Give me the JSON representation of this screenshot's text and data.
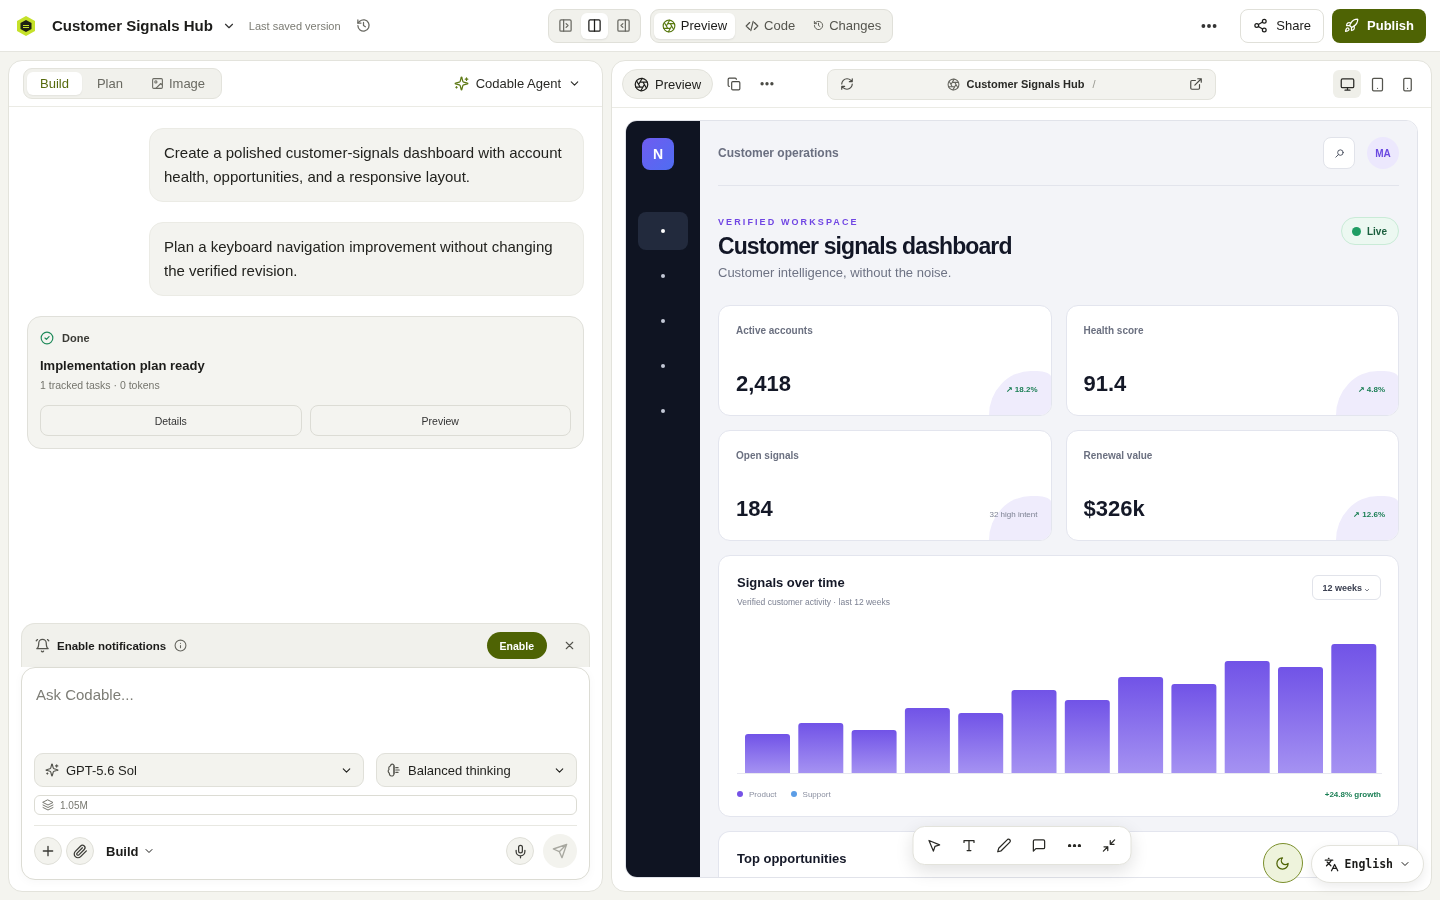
{
  "header": {
    "project_title": "Customer Signals Hub",
    "save_status": "Last saved version",
    "layout_toggles": [
      {
        "kind": "left_panel",
        "selected": false
      },
      {
        "kind": "split",
        "selected": true
      },
      {
        "kind": "right_panel",
        "selected": false
      }
    ],
    "view_tabs": [
      {
        "kind": "preview",
        "label": "Preview",
        "selected": true
      },
      {
        "kind": "code",
        "label": "Code",
        "selected": false
      },
      {
        "kind": "changes",
        "label": "Changes",
        "selected": false
      }
    ],
    "share": "Share",
    "publish": "Publish"
  },
  "chat_panel": {
    "tabs": [
      {
        "kind": "build",
        "label": "Build",
        "selected": true
      },
      {
        "kind": "plan",
        "label": "Plan",
        "selected": false
      },
      {
        "kind": "image",
        "label": "Image",
        "selected": false
      }
    ],
    "agent": "Codable Agent",
    "messages": [
      "Create a polished customer-signals dashboard with account health, opportunities, and a responsive layout.",
      "Plan a keyboard navigation improvement without changing the verified revision."
    ],
    "result_card": {
      "status": "Done",
      "title": "Implementation plan ready",
      "meta": "1 tracked tasks · 0 tokens",
      "buttons": [
        "Details",
        "Preview"
      ]
    },
    "notification": {
      "label": "Enable notifications",
      "button": "Enable"
    },
    "composer": {
      "placeholder": "Ask Codable...",
      "model": "GPT-5.6 Sol",
      "reasoning": "Balanced thinking",
      "context": "1.05M",
      "mode": "Build",
      "send_disabled": true
    }
  },
  "preview_panel": {
    "preview_button": "Preview",
    "address": "Customer Signals Hub",
    "address_separator": "/",
    "devices": [
      {
        "kind": "desktop",
        "selected": true
      },
      {
        "kind": "tablet",
        "selected": false
      },
      {
        "kind": "phone",
        "selected": false
      }
    ],
    "tools": [
      {
        "kind": "select"
      },
      {
        "kind": "text"
      },
      {
        "kind": "draw"
      },
      {
        "kind": "comment"
      },
      {
        "kind": "more"
      },
      {
        "kind": "collapse"
      }
    ],
    "language": "English"
  },
  "preview_app": {
    "logo_letter": "N",
    "nav_items": [
      {
        "selected": true
      },
      {
        "selected": false
      },
      {
        "selected": false
      },
      {
        "selected": false
      },
      {
        "selected": false
      }
    ],
    "breadcrumb": "Customer operations",
    "avatar": "MA",
    "eyebrow": "VERIFIED WORKSPACE",
    "title": "Customer signals dashboard",
    "subtitle": "Customer intelligence, without the noise.",
    "status": "Live",
    "stats": [
      {
        "label": "Active accounts",
        "value": "2,418",
        "badge": "↗ 18.2%",
        "kind": "trend"
      },
      {
        "label": "Health score",
        "value": "91.4",
        "badge": "↗ 4.8%",
        "kind": "trend"
      },
      {
        "label": "Open signals",
        "value": "184",
        "badge": "32 high intent",
        "kind": "note"
      },
      {
        "label": "Renewal value",
        "value": "$326k",
        "badge": "↗ 12.6%",
        "kind": "trend"
      }
    ],
    "chart_card": {
      "title": "Signals over time",
      "subtitle": "Verified customer activity · last 12 weeks",
      "range": "12 weeks",
      "legend": [
        {
          "label": "Product",
          "color": "#7552e6"
        },
        {
          "label": "Support",
          "color": "#5b9de6"
        }
      ],
      "growth": "+24.8% growth"
    },
    "opportunities": {
      "title": "Top opportunities"
    }
  }
}
